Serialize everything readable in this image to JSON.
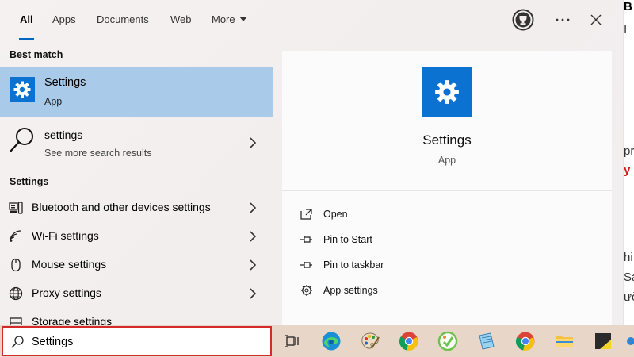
{
  "tabs": [
    {
      "label": "All"
    },
    {
      "label": "Apps"
    },
    {
      "label": "Documents"
    },
    {
      "label": "Web"
    },
    {
      "label": "More"
    }
  ],
  "left": {
    "best_match_header": "Best match",
    "best_match": {
      "title": "Settings",
      "subtitle": "App"
    },
    "web_result": {
      "title": "settings",
      "subtitle": "See more search results"
    },
    "settings_header": "Settings",
    "settings_items": [
      {
        "label": "Bluetooth and other devices settings",
        "icon": "bluetooth-devices-icon"
      },
      {
        "label": "Wi-Fi settings",
        "icon": "wifi-icon"
      },
      {
        "label": "Mouse settings",
        "icon": "mouse-icon"
      },
      {
        "label": "Proxy settings",
        "icon": "globe-icon"
      },
      {
        "label": "Storage settings",
        "icon": "storage-icon"
      }
    ]
  },
  "preview": {
    "name": "Settings",
    "kind": "App",
    "actions": [
      {
        "label": "Open",
        "icon": "open-icon"
      },
      {
        "label": "Pin to Start",
        "icon": "pin-icon"
      },
      {
        "label": "Pin to taskbar",
        "icon": "pin-icon"
      },
      {
        "label": "App settings",
        "icon": "gear-icon"
      }
    ]
  },
  "search": {
    "value": "Settings"
  },
  "background_page": {
    "lines": [
      "B",
      "I",
      "pr",
      "y s",
      "hi",
      "Sau",
      "ườ"
    ]
  },
  "colors": {
    "accent": "#0b72d1",
    "selection": "#a9cbe9",
    "search_border": "#d42a2a",
    "tab_underline": "#0067c0"
  }
}
